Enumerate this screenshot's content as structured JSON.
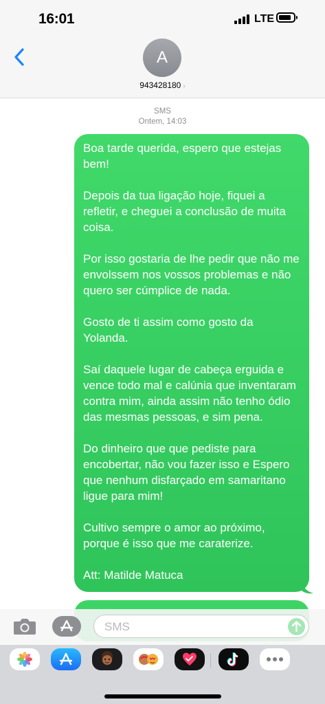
{
  "status_bar": {
    "time": "16:01",
    "network": "LTE"
  },
  "header": {
    "avatar_initial": "A",
    "contact_name": "943428180"
  },
  "thread": {
    "service": "SMS",
    "timestamp": "Ontem, 14:03",
    "message": {
      "paragraphs": [
        "Boa tarde querida, espero que estejas bem!",
        "Depois da tua ligação hoje, fiquei a refletir, e cheguei a conclusão de muita coisa.",
        "Por isso gostaria de lhe pedir que não me envolssem nos vossos problemas e não quero ser cúmplice de nada.",
        "Gosto de ti assim como gosto da Yolanda.",
        "Saí daquele lugar de cabeça erguida e vence todo mal e calúnia que inventaram contra mim, ainda assim não tenho ódio das mesmas pessoas, e sim pena.",
        "Do dinheiro que que pediste para encobertar, não vou fazer isso e Espero que nenhum disfarçado em samaritano ligue para mim!",
        "Cultivo sempre o amor ao próximo, porque é isso que me caraterize.",
        "Att: Matilde Matuca"
      ]
    }
  },
  "compose": {
    "placeholder": "SMS"
  },
  "icons": {
    "back": "chevron-left-icon",
    "camera": "camera-icon",
    "apps": "app-store-icon",
    "send": "arrow-up-icon",
    "drawer": [
      "photos-icon",
      "app-store-icon",
      "memoji-icon",
      "memoji-stickers-icon",
      "digital-touch-icon",
      "tiktok-icon",
      "more-icon"
    ]
  },
  "colors": {
    "bubble": "#34cc5e",
    "accent": "#1a84ff",
    "bar": "#f6f6f6"
  }
}
